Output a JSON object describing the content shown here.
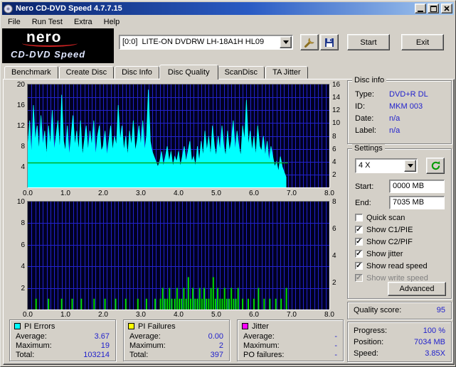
{
  "window": {
    "title": "Nero CD-DVD Speed 4.7.7.15"
  },
  "menu": {
    "items": [
      "File",
      "Run Test",
      "Extra",
      "Help"
    ]
  },
  "logo": {
    "line1": "nero",
    "line2": "CD-DVD Speed"
  },
  "toolbar": {
    "drive_select": {
      "value": "[0:0]  LITE-ON DVDRW LH-18A1H HL09"
    },
    "start_button": "Start",
    "exit_button": "Exit"
  },
  "tabs": {
    "items": [
      "Benchmark",
      "Create Disc",
      "Disc Info",
      "Disc Quality",
      "ScanDisc",
      "TA Jitter"
    ],
    "active": "Disc Quality"
  },
  "disc_info": {
    "title": "Disc info",
    "rows": [
      {
        "label": "Type:",
        "value": "DVD+R DL"
      },
      {
        "label": "ID:",
        "value": "MKM 003"
      },
      {
        "label": "Date:",
        "value": "n/a"
      },
      {
        "label": "Label:",
        "value": "n/a"
      }
    ]
  },
  "settings": {
    "title": "Settings",
    "speed_value": "4 X",
    "start_label": "Start:",
    "start_value": "0000 MB",
    "end_label": "End:",
    "end_value": "7035 MB",
    "checkboxes": [
      {
        "label": "Quick scan",
        "mark": ""
      },
      {
        "label": "Show C1/PIE",
        "mark": "✓"
      },
      {
        "label": "Show C2/PIF",
        "mark": "✓"
      },
      {
        "label": "Show jitter",
        "mark": "✓"
      },
      {
        "label": "Show read speed",
        "mark": "✓"
      },
      {
        "label": "Show write speed",
        "mark": "✓"
      }
    ],
    "advanced_button": "Advanced"
  },
  "quality": {
    "label": "Quality score:",
    "value": "95"
  },
  "progress": {
    "rows": [
      {
        "label": "Progress:",
        "value": "100 %"
      },
      {
        "label": "Position:",
        "value": "7034 MB"
      },
      {
        "label": "Speed:",
        "value": "3.85X"
      }
    ]
  },
  "legends": [
    {
      "title": "PI Errors",
      "swatch": "#00ffff",
      "rows": [
        {
          "label": "Average:",
          "value": "3.67"
        },
        {
          "label": "Maximum:",
          "value": "19"
        },
        {
          "label": "Total:",
          "value": "103214"
        }
      ]
    },
    {
      "title": "PI Failures",
      "swatch": "#ffff00",
      "rows": [
        {
          "label": "Average:",
          "value": "0.00"
        },
        {
          "label": "Maximum:",
          "value": "2"
        },
        {
          "label": "Total:",
          "value": "397"
        }
      ]
    },
    {
      "title": "Jitter",
      "swatch": "#ff00ff",
      "rows": [
        {
          "label": "Average:",
          "value": "-"
        },
        {
          "label": "Maximum:",
          "value": "-"
        },
        {
          "label": "PO failures:",
          "value": "-"
        }
      ]
    }
  ],
  "chart_data": [
    {
      "name": "pi-errors-chart",
      "type": "area",
      "title": "PI Errors vs disc position (GB)",
      "x_start": 0,
      "x_step": 0.05,
      "xlim": [
        0,
        8
      ],
      "x_ticks": [
        "0.0",
        "1.0",
        "2.0",
        "3.0",
        "4.0",
        "5.0",
        "6.0",
        "7.0",
        "8.0"
      ],
      "left_axis": {
        "min": 0,
        "max": 20,
        "ticks": [
          "4",
          "8",
          "12",
          "16",
          "20"
        ]
      },
      "right_axis": {
        "min": 0,
        "max": 16,
        "ticks": [
          "2",
          "4",
          "6",
          "8",
          "10",
          "12",
          "14",
          "16"
        ]
      },
      "grid": {
        "x_step": 0.1,
        "y_step": 2,
        "h_axis": "right"
      },
      "colors": {
        "bg": "#000022",
        "grid": "#2222cc"
      },
      "series_color": "#00ffff",
      "values": [
        8,
        13,
        6,
        16,
        9,
        12,
        7,
        14,
        8,
        11,
        6,
        12,
        8,
        15,
        7,
        10,
        13,
        7,
        18,
        9,
        7,
        12,
        6,
        10,
        14,
        8,
        11,
        7,
        13,
        6,
        9,
        12,
        7,
        11,
        8,
        13,
        6,
        10,
        12,
        7,
        8,
        11,
        6,
        9,
        12,
        7,
        10,
        8,
        16,
        9,
        12,
        7,
        10,
        6,
        11,
        8,
        13,
        7,
        9,
        12,
        8,
        13,
        7,
        10,
        19,
        9,
        7,
        6,
        5,
        4,
        5,
        7,
        4,
        6,
        8,
        5,
        7,
        4,
        6,
        5,
        7,
        4,
        6,
        8,
        5,
        7,
        9,
        5,
        6,
        4,
        8,
        5,
        9,
        6,
        11,
        7,
        10,
        6,
        12,
        8,
        6,
        10,
        7,
        12,
        8,
        6,
        11,
        7,
        9,
        13,
        7,
        11,
        8,
        6,
        12,
        9,
        17,
        8,
        11,
        7,
        10,
        6,
        12,
        8,
        7,
        10,
        6,
        9,
        5,
        8,
        6,
        4,
        5,
        3,
        6,
        4,
        3,
        2
      ],
      "overlay_line": {
        "axis": "right",
        "value": 3.85,
        "x_from": 0,
        "x_to": 6.9,
        "color": "#00a000",
        "label": "read speed"
      }
    },
    {
      "name": "pi-failures-chart",
      "type": "bar",
      "title": "PI Failures vs disc position (GB)",
      "xlim": [
        0,
        8
      ],
      "x_ticks": [
        "0.0",
        "1.0",
        "2.0",
        "3.0",
        "4.0",
        "5.0",
        "6.0",
        "7.0",
        "8.0"
      ],
      "left_axis": {
        "min": 0,
        "max": 10,
        "ticks": [
          "2",
          "4",
          "6",
          "8",
          "10"
        ]
      },
      "right_axis": {
        "min": 0,
        "max": 8,
        "ticks": [
          "2",
          "4",
          "6",
          "8"
        ]
      },
      "grid": {
        "x_step": 0.1,
        "y_step": 2,
        "h_axis": "left"
      },
      "colors": {
        "bg": "#000022",
        "grid": "#2222cc"
      },
      "bar_color": "#00dd00",
      "bars": [
        [
          0.22,
          1
        ],
        [
          0.55,
          1
        ],
        [
          0.9,
          1
        ],
        [
          1.18,
          1
        ],
        [
          1.42,
          1
        ],
        [
          1.76,
          1
        ],
        [
          2.05,
          1
        ],
        [
          2.33,
          1
        ],
        [
          2.6,
          1
        ],
        [
          2.92,
          1
        ],
        [
          3.15,
          1
        ],
        [
          3.38,
          1
        ],
        [
          3.52,
          1
        ],
        [
          3.58,
          2
        ],
        [
          3.64,
          1
        ],
        [
          3.7,
          1
        ],
        [
          3.76,
          2
        ],
        [
          3.82,
          1
        ],
        [
          3.9,
          1
        ],
        [
          3.96,
          2
        ],
        [
          4.02,
          1
        ],
        [
          4.08,
          1
        ],
        [
          4.14,
          2
        ],
        [
          4.2,
          1
        ],
        [
          4.26,
          3
        ],
        [
          4.32,
          1
        ],
        [
          4.38,
          2
        ],
        [
          4.44,
          1
        ],
        [
          4.5,
          1
        ],
        [
          4.56,
          2
        ],
        [
          4.62,
          1
        ],
        [
          4.68,
          2
        ],
        [
          4.74,
          1
        ],
        [
          4.8,
          1
        ],
        [
          4.86,
          2
        ],
        [
          4.92,
          3
        ],
        [
          4.98,
          1
        ],
        [
          5.04,
          2
        ],
        [
          5.1,
          1
        ],
        [
          5.16,
          1
        ],
        [
          5.22,
          2
        ],
        [
          5.28,
          1
        ],
        [
          5.34,
          1
        ],
        [
          5.4,
          2
        ],
        [
          5.46,
          1
        ],
        [
          5.52,
          1
        ],
        [
          5.58,
          2
        ],
        [
          5.7,
          1
        ],
        [
          5.85,
          1
        ],
        [
          6.0,
          1
        ],
        [
          6.12,
          2
        ],
        [
          6.27,
          1
        ],
        [
          6.42,
          1
        ],
        [
          6.58,
          1
        ],
        [
          6.72,
          1
        ],
        [
          6.86,
          2
        ]
      ]
    }
  ]
}
